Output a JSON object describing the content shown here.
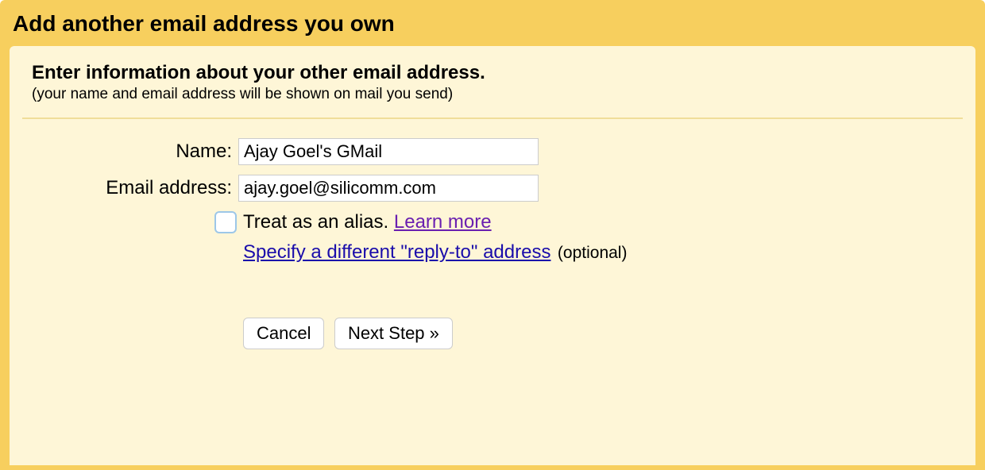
{
  "dialog": {
    "title": "Add another email address you own",
    "section_title": "Enter information about your other email address.",
    "section_subtitle": "(your name and email address will be shown on mail you send)"
  },
  "form": {
    "name_label": "Name:",
    "name_value": "Ajay Goel's GMail",
    "email_label": "Email address:",
    "email_value": "ajay.goel@silicomm.com",
    "alias_text": "Treat as an alias. ",
    "learn_more": "Learn more",
    "reply_to_link": "Specify a different \"reply-to\" address",
    "optional": "(optional)"
  },
  "buttons": {
    "cancel": "Cancel",
    "next": "Next Step »"
  }
}
